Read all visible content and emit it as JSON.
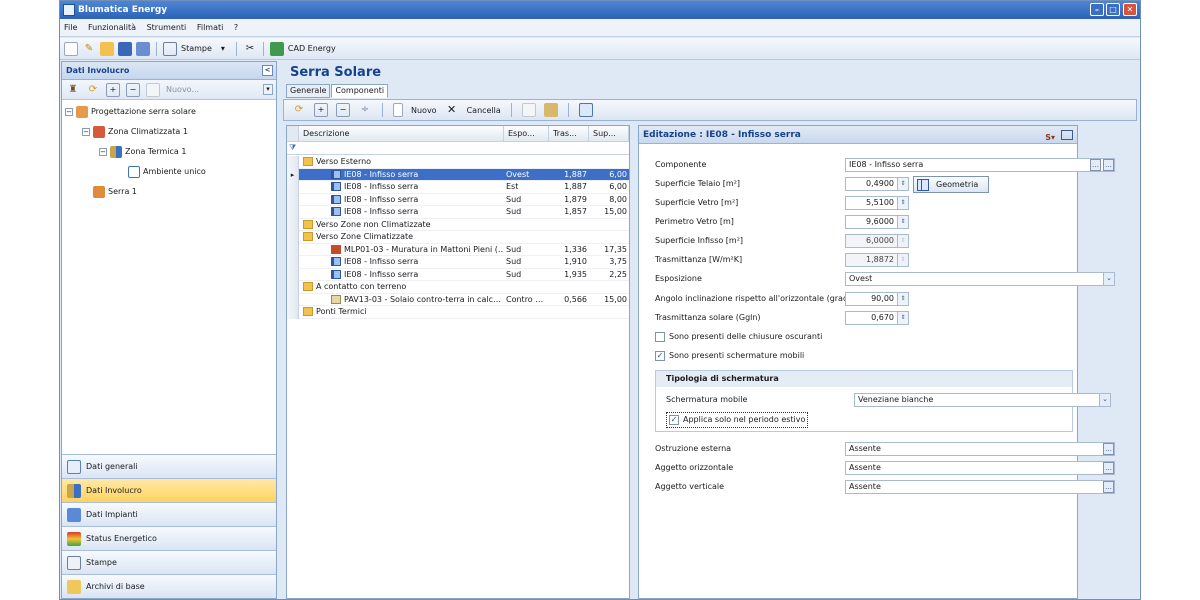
{
  "app": {
    "title": "Blumatica Energy"
  },
  "menu": [
    "File",
    "Funzionalità",
    "Strumenti",
    "Filmati",
    "?"
  ],
  "toolbar": {
    "stampe_label": "Stampe",
    "cad_label": "CAD Energy"
  },
  "left_panel": {
    "title": "Dati Involucro",
    "new_label": "Nuovo...",
    "tree": [
      {
        "label": "Progettazione serra solare"
      },
      {
        "label": "Zona Climatizzata 1"
      },
      {
        "label": "Zona Termica 1"
      },
      {
        "label": "Ambiente unico"
      },
      {
        "label": "Serra 1"
      }
    ],
    "nav": [
      {
        "label": "Dati generali"
      },
      {
        "label": "Dati Involucro"
      },
      {
        "label": "Dati Impianti"
      },
      {
        "label": "Status Energetico"
      },
      {
        "label": "Stampe"
      },
      {
        "label": "Archivi di base"
      }
    ]
  },
  "main": {
    "title": "Serra Solare",
    "tabs": [
      "Generale",
      "Componenti"
    ],
    "sub_toolbar": {
      "nuovo": "Nuovo",
      "cancella": "Cancella"
    }
  },
  "grid": {
    "columns": [
      "Descrizione",
      "Espo...",
      "Tras...",
      "Sup..."
    ],
    "rows": [
      {
        "desc": "Verso Esterno",
        "espo": "",
        "tras": "",
        "sup": ""
      },
      {
        "desc": "IE08 - Infisso serra",
        "espo": "Ovest",
        "tras": "1,887",
        "sup": "6,00"
      },
      {
        "desc": "IE08 - Infisso serra",
        "espo": "Est",
        "tras": "1,887",
        "sup": "6,00"
      },
      {
        "desc": "IE08 - Infisso serra",
        "espo": "Sud",
        "tras": "1,879",
        "sup": "8,00"
      },
      {
        "desc": "IE08 - Infisso serra",
        "espo": "Sud",
        "tras": "1,857",
        "sup": "15,00"
      },
      {
        "desc": "Verso Zone non Climatizzate",
        "espo": "",
        "tras": "",
        "sup": ""
      },
      {
        "desc": "Verso Zone Climatizzate",
        "espo": "",
        "tras": "",
        "sup": ""
      },
      {
        "desc": "MLP01-03 - Muratura in Mattoni Pieni (…",
        "espo": "Sud",
        "tras": "1,336",
        "sup": "17,35"
      },
      {
        "desc": "IE08 - Infisso serra",
        "espo": "Sud",
        "tras": "1,910",
        "sup": "3,75"
      },
      {
        "desc": "IE08 - Infisso serra",
        "espo": "Sud",
        "tras": "1,935",
        "sup": "2,25"
      },
      {
        "desc": "A contatto con terreno",
        "espo": "",
        "tras": "",
        "sup": ""
      },
      {
        "desc": "PAV13-03 - Solaio contro-terra in calc…",
        "espo": "Contro …",
        "tras": "0,566",
        "sup": "15,00"
      },
      {
        "desc": "Ponti Termici",
        "espo": "",
        "tras": "",
        "sup": ""
      }
    ]
  },
  "editor": {
    "title": "Editazione : IE08 - Infisso serra",
    "fields": {
      "componente": {
        "label": "Componente",
        "value": "IE08 - Infisso serra"
      },
      "superficie_telaio": {
        "label": "Superficie Telaio [m²]",
        "value": "0,4900"
      },
      "superficie_vetro": {
        "label": "Superficie Vetro [m²]",
        "value": "5,5100"
      },
      "perimetro_vetro": {
        "label": "Perimetro Vetro [m]",
        "value": "9,6000"
      },
      "superficie_infisso": {
        "label": "Superficie Infisso [m²]",
        "value": "6,0000"
      },
      "trasmittanza": {
        "label": "Trasmittanza [W/m²K]",
        "value": "1,8872"
      },
      "esposizione": {
        "label": "Esposizione",
        "value": "Ovest"
      },
      "angolo": {
        "label": "Angolo inclinazione rispetto all'orizzontale (gradi)",
        "value": "90,00"
      },
      "trasmittanza_solare": {
        "label": "Trasmittanza solare (Ggln)",
        "value": "0,670"
      }
    },
    "geometria_label": "Geometria",
    "check_oscuranti": {
      "label": "Sono presenti delle chiusure oscuranti",
      "checked": false
    },
    "check_schermature": {
      "label": "Sono presenti schermature mobili",
      "checked": true
    },
    "group_title": "Tipologia di schermatura",
    "schermatura_mobile": {
      "label": "Schermatura mobile",
      "value": "Veneziane bianche"
    },
    "check_estivo": {
      "label": "Applica solo nel periodo estivo",
      "checked": true
    },
    "ostruzione": {
      "label": "Ostruzione esterna",
      "value": "Assente"
    },
    "aggetto_orizz": {
      "label": "Aggetto orizzontale",
      "value": "Assente"
    },
    "aggetto_vert": {
      "label": "Aggetto verticale",
      "value": "Assente"
    }
  }
}
